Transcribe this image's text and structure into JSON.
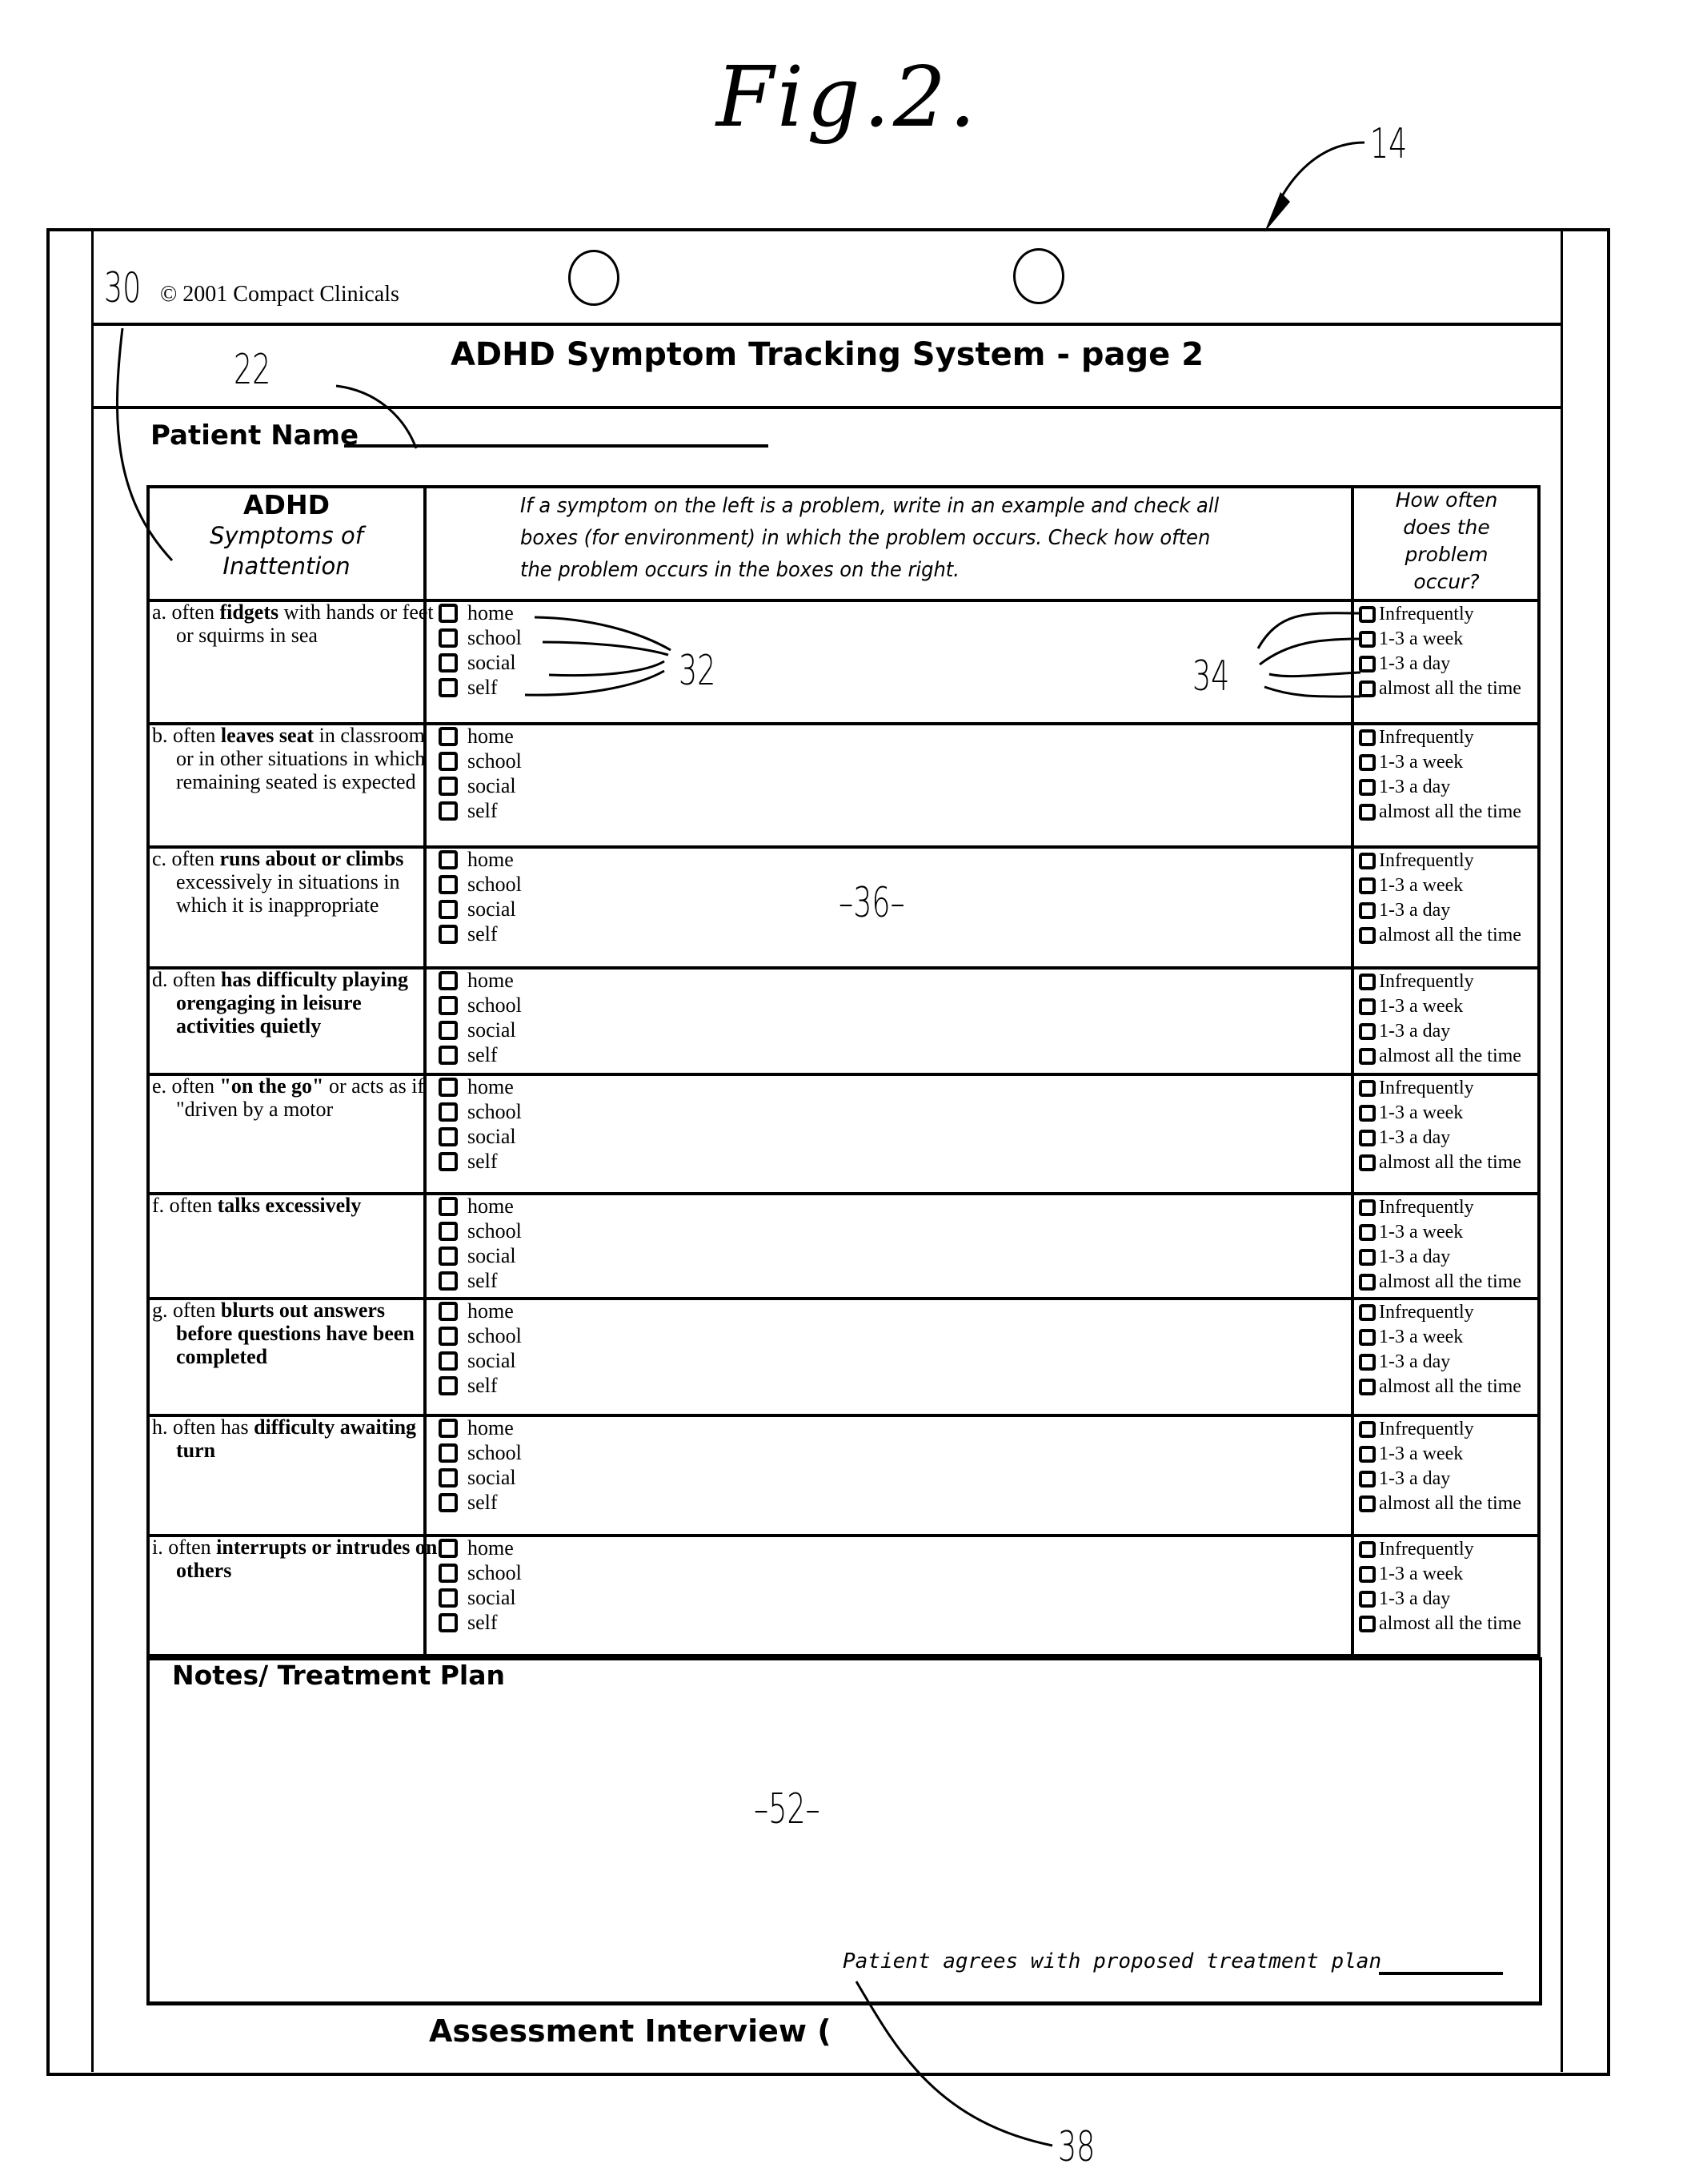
{
  "figure": {
    "title": "Fig.2.",
    "refs": {
      "r14": "14",
      "r30": "30",
      "r22": "22",
      "r32": "32",
      "r34": "34",
      "r36": "–36–",
      "r52": "–52–",
      "r38": "38"
    }
  },
  "form": {
    "copyright": "© 2001 Compact Clinicals",
    "title": "ADHD Symptom Tracking System - page 2",
    "patient_name_label": "Patient Name",
    "header": {
      "col1_title": "ADHD",
      "col1_sub1": "Symptoms of",
      "col1_sub2": "Inattention",
      "col2_text": "If a symptom on the left is a problem, write in an example and check all boxes (for environment) in which the problem occurs. Check how often the problem occurs in the boxes on the right.",
      "col3_text": "How often does the problem occur?"
    },
    "environments": [
      "home",
      "school",
      "social",
      "self"
    ],
    "frequencies": [
      "Infrequently",
      "1-3 a week",
      "1-3 a day",
      "almost all the time"
    ],
    "symptoms": [
      {
        "letter": "a.",
        "pre": "often",
        "bold": "fidgets",
        "post": "with hands or feet or squirms in sea"
      },
      {
        "letter": "b.",
        "pre": "often",
        "bold": "leaves seat",
        "post": "in classroom or in other situations in which remaining seated is expected"
      },
      {
        "letter": "c.",
        "pre": "often",
        "bold": "runs about or climbs",
        "post": "excessively in situations in which it is inappropriate"
      },
      {
        "letter": "d.",
        "pre": "often",
        "bold": "has difficulty playing orengaging in leisure activities quietly",
        "post": ""
      },
      {
        "letter": "e.",
        "pre": "often",
        "bold": "\"on the go\"",
        "post": "or acts as if \"driven by a motor"
      },
      {
        "letter": "f.",
        "pre": "often",
        "bold": "talks excessively",
        "post": ""
      },
      {
        "letter": "g.",
        "pre": "often",
        "bold": "blurts out answers before questions have been completed",
        "post": ""
      },
      {
        "letter": "h.",
        "pre": "often has",
        "bold": "difficulty awaiting turn",
        "post": ""
      },
      {
        "letter": "i.",
        "pre": "often",
        "bold": "interrupts or intrudes on others",
        "post": ""
      }
    ],
    "notes_title": "Notes/ Treatment Plan",
    "agree_text": "Patient agrees with proposed treatment plan",
    "footer_title": "Assessment Interview ("
  }
}
